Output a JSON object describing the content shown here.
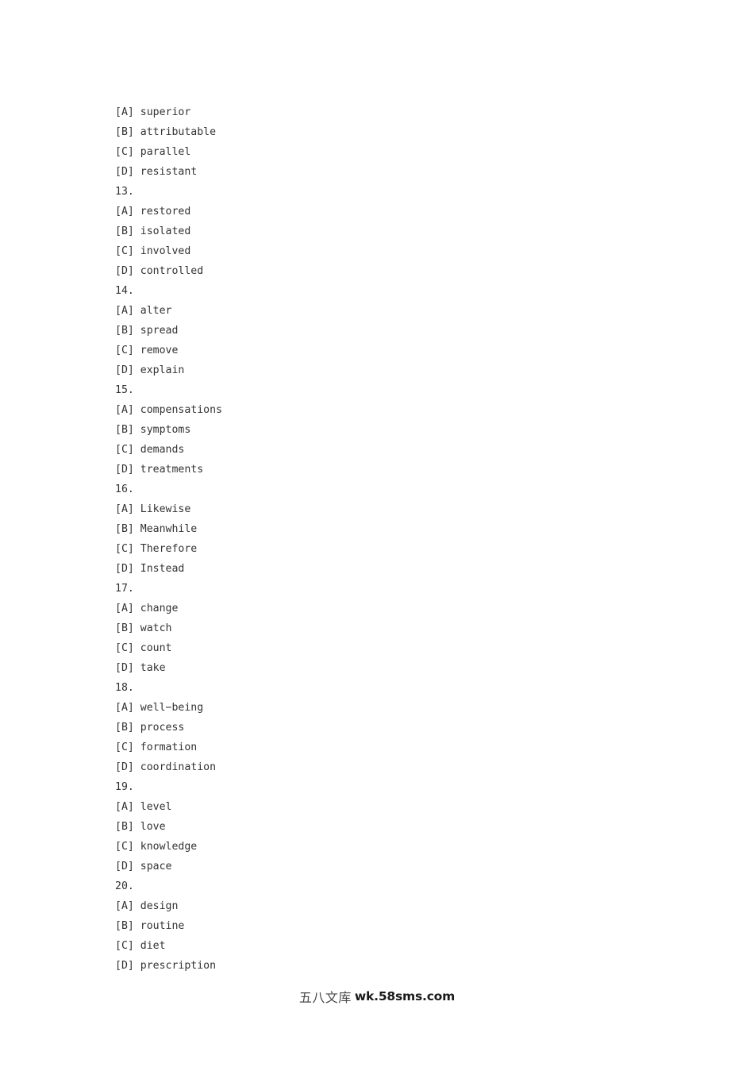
{
  "document": {
    "type": "exam-answer-options",
    "background_color": "#ffffff",
    "text_color": "#333333"
  },
  "lines": [
    {
      "id": "l01",
      "kind": "option",
      "text": "[A] superior"
    },
    {
      "id": "l02",
      "kind": "option",
      "text": "[B] attributable"
    },
    {
      "id": "l03",
      "kind": "option",
      "text": "[C] parallel"
    },
    {
      "id": "l04",
      "kind": "option",
      "text": "[D] resistant"
    },
    {
      "id": "l05",
      "kind": "number",
      "text": "13."
    },
    {
      "id": "l06",
      "kind": "option",
      "text": "[A] restored"
    },
    {
      "id": "l07",
      "kind": "option",
      "text": "[B] isolated"
    },
    {
      "id": "l08",
      "kind": "option",
      "text": "[C] involved"
    },
    {
      "id": "l09",
      "kind": "option",
      "text": "[D] controlled"
    },
    {
      "id": "l10",
      "kind": "number",
      "text": "14."
    },
    {
      "id": "l11",
      "kind": "option",
      "text": "[A] alter"
    },
    {
      "id": "l12",
      "kind": "option",
      "text": "[B] spread"
    },
    {
      "id": "l13",
      "kind": "option",
      "text": "[C] remove"
    },
    {
      "id": "l14",
      "kind": "option",
      "text": "[D] explain"
    },
    {
      "id": "l15",
      "kind": "number",
      "text": "15."
    },
    {
      "id": "l16",
      "kind": "option",
      "text": "[A] compensations"
    },
    {
      "id": "l17",
      "kind": "option",
      "text": "[B] symptoms"
    },
    {
      "id": "l18",
      "kind": "option",
      "text": "[C] demands"
    },
    {
      "id": "l19",
      "kind": "option",
      "text": "[D] treatments"
    },
    {
      "id": "l20",
      "kind": "number",
      "text": "16."
    },
    {
      "id": "l21",
      "kind": "option",
      "text": "[A] Likewise"
    },
    {
      "id": "l22",
      "kind": "option",
      "text": "[B] Meanwhile"
    },
    {
      "id": "l23",
      "kind": "option",
      "text": "[C] Therefore"
    },
    {
      "id": "l24",
      "kind": "option",
      "text": "[D] Instead"
    },
    {
      "id": "l25",
      "kind": "number",
      "text": "17."
    },
    {
      "id": "l26",
      "kind": "option",
      "text": "[A] change"
    },
    {
      "id": "l27",
      "kind": "option",
      "text": "[B] watch"
    },
    {
      "id": "l28",
      "kind": "option",
      "text": "[C] count"
    },
    {
      "id": "l29",
      "kind": "option",
      "text": "[D] take"
    },
    {
      "id": "l30",
      "kind": "number",
      "text": "18."
    },
    {
      "id": "l31",
      "kind": "option",
      "text": "[A] well−being"
    },
    {
      "id": "l32",
      "kind": "option",
      "text": "[B] process"
    },
    {
      "id": "l33",
      "kind": "option",
      "text": "[C] formation"
    },
    {
      "id": "l34",
      "kind": "option",
      "text": "[D] coordination"
    },
    {
      "id": "l35",
      "kind": "number",
      "text": "19."
    },
    {
      "id": "l36",
      "kind": "option",
      "text": "[A] level"
    },
    {
      "id": "l37",
      "kind": "option",
      "text": "[B] love"
    },
    {
      "id": "l38",
      "kind": "option",
      "text": "[C] knowledge"
    },
    {
      "id": "l39",
      "kind": "option",
      "text": "[D] space"
    },
    {
      "id": "l40",
      "kind": "number",
      "text": "20."
    },
    {
      "id": "l41",
      "kind": "option",
      "text": "[A] design"
    },
    {
      "id": "l42",
      "kind": "option",
      "text": "[B] routine"
    },
    {
      "id": "l43",
      "kind": "option",
      "text": "[C] diet"
    },
    {
      "id": "l44",
      "kind": "option",
      "text": "[D] prescription"
    }
  ],
  "questions": [
    {
      "number": "13.",
      "options": [
        {
          "label": "[A]",
          "text": "restored"
        },
        {
          "label": "[B]",
          "text": "isolated"
        },
        {
          "label": "[C]",
          "text": "involved"
        },
        {
          "label": "[D]",
          "text": "controlled"
        }
      ]
    },
    {
      "number": "14.",
      "options": [
        {
          "label": "[A]",
          "text": "alter"
        },
        {
          "label": "[B]",
          "text": "spread"
        },
        {
          "label": "[C]",
          "text": "remove"
        },
        {
          "label": "[D]",
          "text": "explain"
        }
      ]
    },
    {
      "number": "15.",
      "options": [
        {
          "label": "[A]",
          "text": "compensations"
        },
        {
          "label": "[B]",
          "text": "symptoms"
        },
        {
          "label": "[C]",
          "text": "demands"
        },
        {
          "label": "[D]",
          "text": "treatments"
        }
      ]
    },
    {
      "number": "16.",
      "options": [
        {
          "label": "[A]",
          "text": "Likewise"
        },
        {
          "label": "[B]",
          "text": "Meanwhile"
        },
        {
          "label": "[C]",
          "text": "Therefore"
        },
        {
          "label": "[D]",
          "text": "Instead"
        }
      ]
    },
    {
      "number": "17.",
      "options": [
        {
          "label": "[A]",
          "text": "change"
        },
        {
          "label": "[B]",
          "text": "watch"
        },
        {
          "label": "[C]",
          "text": "count"
        },
        {
          "label": "[D]",
          "text": "take"
        }
      ]
    },
    {
      "number": "18.",
      "options": [
        {
          "label": "[A]",
          "text": "well−being"
        },
        {
          "label": "[B]",
          "text": "process"
        },
        {
          "label": "[C]",
          "text": "formation"
        },
        {
          "label": "[D]",
          "text": "coordination"
        }
      ]
    },
    {
      "number": "19.",
      "options": [
        {
          "label": "[A]",
          "text": "level"
        },
        {
          "label": "[B]",
          "text": "love"
        },
        {
          "label": "[C]",
          "text": "knowledge"
        },
        {
          "label": "[D]",
          "text": "space"
        }
      ]
    },
    {
      "number": "20.",
      "options": [
        {
          "label": "[A]",
          "text": "design"
        },
        {
          "label": "[B]",
          "text": "routine"
        },
        {
          "label": "[C]",
          "text": "diet"
        },
        {
          "label": "[D]",
          "text": "prescription"
        }
      ]
    }
  ],
  "footer": {
    "site_name_cjk": "五八文库",
    "site_url": "wk.58sms.com"
  }
}
